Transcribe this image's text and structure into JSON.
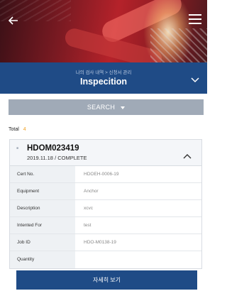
{
  "header": {
    "back_icon": "arrow-left-icon",
    "menu_icon": "hamburger-menu-icon",
    "breadcrumb": "나의 검사 내역 > 신청서 관리",
    "title": "Inspecition",
    "collapse_icon": "chevron-down-icon"
  },
  "search": {
    "label": "SEARCH",
    "icon": "caret-down-icon"
  },
  "total": {
    "label": "Total",
    "count": "4"
  },
  "card": {
    "cert_id": "HDOM023419",
    "subtitle": "2019.11.18 / COMPLETE",
    "toggle_icon": "chevron-up-icon",
    "rows": [
      {
        "label": "Cert No.",
        "value": "HDOEH-0006-19"
      },
      {
        "label": "Equipment",
        "value": "Anchor"
      },
      {
        "label": "Description",
        "value": "xcvc"
      },
      {
        "label": "Intented For",
        "value": "test"
      },
      {
        "label": "Job ID",
        "value": "HDO-M0138-19"
      },
      {
        "label": "Quantity",
        "value": ""
      }
    ]
  },
  "detail_button": {
    "label": "자세히 보기"
  },
  "colors": {
    "primary": "#1f4b86",
    "search_bar": "#a0aab7",
    "total_count": "#f0a020"
  }
}
